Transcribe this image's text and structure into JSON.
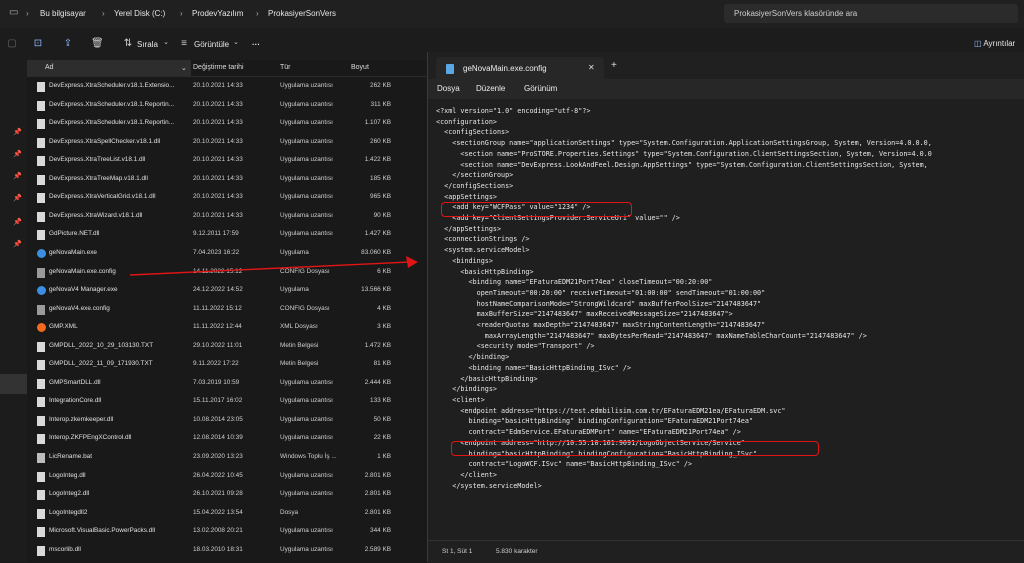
{
  "address_bar": {
    "crumbs": [
      "Bu bilgisayar",
      "Yerel Disk (C:)",
      "ProdevYazılım",
      "ProkasiyerSonVers"
    ],
    "search_placeholder": "ProkasiyerSonVers klasöründe ara"
  },
  "toolbar": {
    "sort_label": "Sırala",
    "view_label": "Görüntüle",
    "more_label": "···",
    "details_label": "Ayrıntılar"
  },
  "columns": {
    "name": "Ad",
    "date": "Değiştirme tarihi",
    "type": "Tür",
    "size": "Boyut"
  },
  "files": [
    {
      "name": "DevExpress.XtraScheduler.v18.1.Extensio...",
      "date": "20.10.2021 14:33",
      "type": "Uygulama uzantısı",
      "size": "262 KB",
      "icon": "dll"
    },
    {
      "name": "DevExpress.XtraScheduler.v18.1.Reportin...",
      "date": "20.10.2021 14:33",
      "type": "Uygulama uzantısı",
      "size": "311 KB",
      "icon": "dll"
    },
    {
      "name": "DevExpress.XtraScheduler.v18.1.Reportin...",
      "date": "20.10.2021 14:33",
      "type": "Uygulama uzantısı",
      "size": "1.107 KB",
      "icon": "dll"
    },
    {
      "name": "DevExpress.XtraSpellChecker.v18.1.dll",
      "date": "20.10.2021 14:33",
      "type": "Uygulama uzantısı",
      "size": "260 KB",
      "icon": "dll"
    },
    {
      "name": "DevExpress.XtraTreeList.v18.1.dll",
      "date": "20.10.2021 14:33",
      "type": "Uygulama uzantısı",
      "size": "1.422 KB",
      "icon": "dll"
    },
    {
      "name": "DevExpress.XtraTreeMap.v18.1.dll",
      "date": "20.10.2021 14:33",
      "type": "Uygulama uzantısı",
      "size": "185 KB",
      "icon": "dll"
    },
    {
      "name": "DevExpress.XtraVerticalGrid.v18.1.dll",
      "date": "20.10.2021 14:33",
      "type": "Uygulama uzantısı",
      "size": "965 KB",
      "icon": "dll"
    },
    {
      "name": "DevExpress.XtraWizard.v18.1.dll",
      "date": "20.10.2021 14:33",
      "type": "Uygulama uzantısı",
      "size": "90 KB",
      "icon": "dll"
    },
    {
      "name": "GdPicture.NET.dll",
      "date": "9.12.2011 17:59",
      "type": "Uygulama uzantısı",
      "size": "1.427 KB",
      "icon": "dll"
    },
    {
      "name": "geNovaMain.exe",
      "date": "7.04.2023 16:22",
      "type": "Uygulama",
      "size": "83.060 KB",
      "icon": "exe"
    },
    {
      "name": "geNovaMain.exe.config",
      "date": "14.11.2022 15:12",
      "type": "CONFIG Dosyası",
      "size": "6 KB",
      "icon": "config"
    },
    {
      "name": "geNovaV4 Manager.exe",
      "date": "24.12.2022 14:52",
      "type": "Uygulama",
      "size": "13.566 KB",
      "icon": "exe"
    },
    {
      "name": "geNovaV4.exe.config",
      "date": "11.11.2022 15:12",
      "type": "CONFIG Dosyası",
      "size": "4 KB",
      "icon": "config"
    },
    {
      "name": "GMP.XML",
      "date": "11.11.2022 12:44",
      "type": "XML Dosyası",
      "size": "3 KB",
      "icon": "xml"
    },
    {
      "name": "GMPDLL_2022_10_29_103130.TXT",
      "date": "29.10.2022 11:01",
      "type": "Metin Belgesi",
      "size": "1.472 KB",
      "icon": "txt"
    },
    {
      "name": "GMPDLL_2022_11_09_171930.TXT",
      "date": "9.11.2022 17:22",
      "type": "Metin Belgesi",
      "size": "81 KB",
      "icon": "txt"
    },
    {
      "name": "GMPSmartDLL.dll",
      "date": "7.03.2019 10:59",
      "type": "Uygulama uzantısı",
      "size": "2.444 KB",
      "icon": "dll"
    },
    {
      "name": "IntegrationCore.dll",
      "date": "15.11.2017 16:02",
      "type": "Uygulama uzantısı",
      "size": "133 KB",
      "icon": "dll"
    },
    {
      "name": "Interop.zkemkeeper.dll",
      "date": "10.08.2014 23:05",
      "type": "Uygulama uzantısı",
      "size": "50 KB",
      "icon": "dll"
    },
    {
      "name": "Interop.ZKFPEngXControl.dll",
      "date": "12.08.2014 10:39",
      "type": "Uygulama uzantısı",
      "size": "22 KB",
      "icon": "dll"
    },
    {
      "name": "LicRename.bat",
      "date": "23.09.2020 13:23",
      "type": "Windows Toplu İş ...",
      "size": "1 KB",
      "icon": "bat"
    },
    {
      "name": "LogoInteg.dll",
      "date": "26.04.2022 10:45",
      "type": "Uygulama uzantısı",
      "size": "2.801 KB",
      "icon": "dll"
    },
    {
      "name": "LogoInteg2.dll",
      "date": "26.10.2021 09:28",
      "type": "Uygulama uzantısı",
      "size": "2.801 KB",
      "icon": "dll"
    },
    {
      "name": "LogoIntegdll2",
      "date": "15.04.2022 13:54",
      "type": "Dosya",
      "size": "2.801 KB",
      "icon": "file"
    },
    {
      "name": "Microsoft.VisualBasic.PowerPacks.dll",
      "date": "13.02.2008 20:21",
      "type": "Uygulama uzantısı",
      "size": "344 KB",
      "icon": "dll"
    },
    {
      "name": "mscorlib.dll",
      "date": "18.03.2010 18:31",
      "type": "Uygulama uzantısı",
      "size": "2.589 KB",
      "icon": "dll"
    }
  ],
  "notepad": {
    "tab_title": "geNovaMain.exe.config",
    "menu": [
      "Dosya",
      "Düzenle",
      "Görünüm"
    ],
    "lines": [
      "<?xml version=\"1.0\" encoding=\"utf-8\"?>",
      "<configuration>",
      "  <configSections>",
      "    <sectionGroup name=\"applicationSettings\" type=\"System.Configuration.ApplicationSettingsGroup, System, Version=4.0.0.0,",
      "      <section name=\"ProSTORE.Properties.Settings\" type=\"System.Configuration.ClientSettingsSection, System, Version=4.0.0",
      "      <section name=\"DevExpress.LookAndFeel.Design.AppSettings\" type=\"System.Configuration.ClientSettingsSection, System,",
      "    </sectionGroup>",
      "  </configSections>",
      "  <appSettings>",
      "    <add key=\"WCFPass\" value=\"1234\" />",
      "    <add key=\"ClientSettingsProvider.ServiceUri\" value=\"\" />",
      "  </appSettings>",
      "  <connectionStrings />",
      "  <system.serviceModel>",
      "    <bindings>",
      "      <basicHttpBinding>",
      "        <binding name=\"EFaturaEDM21Port74ea\" closeTimeout=\"00:20:00\"",
      "          openTimeout=\"00:20:00\" receiveTimeout=\"01:00:00\" sendTimeout=\"01:00:00\"",
      "          hostNameComparisonMode=\"StrongWildcard\" maxBufferPoolSize=\"2147483647\"",
      "          maxBufferSize=\"2147483647\" maxReceivedMessageSize=\"2147483647\">",
      "          <readerQuotas maxDepth=\"2147483647\" maxStringContentLength=\"2147483647\"",
      "            maxArrayLength=\"2147483647\" maxBytesPerRead=\"2147483647\" maxNameTableCharCount=\"2147483647\" />",
      "          <security mode=\"Transport\" />",
      "        </binding>",
      "        <binding name=\"BasicHttpBinding_ISvc\" />",
      "      </basicHttpBinding>",
      "    </bindings>",
      "    <client>",
      "      <endpoint address=\"https://test.edmbilisim.com.tr/EFaturaEDM21ea/EFaturaEDM.svc\"",
      "        binding=\"basicHttpBinding\" bindingConfiguration=\"EFaturaEDM21Port74ea\"",
      "        contract=\"EdmService.EFaturaEDMPort\" name=\"EFaturaEDM21Port74ea\" />",
      "      <endpoint address=\"http://10.55.10.161:9091/LogoObjectService/Service\"",
      "        binding=\"basicHttpBinding\" bindingConfiguration=\"BasicHttpBinding_ISvc\"",
      "        contract=\"LogoWCF.ISvc\" name=\"BasicHttpBinding_ISvc\" />",
      "      </client>",
      "    </system.serviceModel>"
    ],
    "status_position": "St 1, Süt 1",
    "status_chars": "5.830 karakter"
  },
  "colors": {
    "highlight": "#e01515",
    "icon_dll": "#d9d9d9",
    "icon_exe": "#3c8fe0",
    "icon_config": "#9a9a9a",
    "icon_xml": "#f26b1d"
  }
}
